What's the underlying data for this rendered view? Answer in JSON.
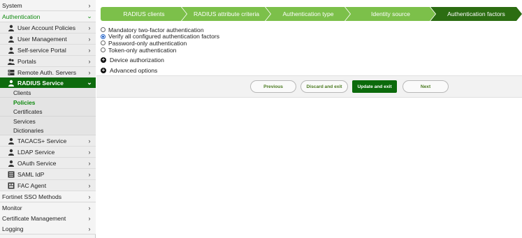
{
  "sidebar": {
    "items": [
      {
        "label": "System",
        "chevron": "›"
      },
      {
        "label": "Authentication",
        "chevron": "⌄"
      },
      {
        "label": "User Account Policies",
        "icon": "users-icon",
        "chevron": "›"
      },
      {
        "label": "User Management",
        "icon": "users-icon",
        "chevron": "›"
      },
      {
        "label": "Self-service Portal",
        "icon": "users-icon",
        "chevron": "›"
      },
      {
        "label": "Portals",
        "icon": "people-icon",
        "chevron": "›"
      },
      {
        "label": "Remote Auth. Servers",
        "icon": "server-icon",
        "chevron": "›"
      },
      {
        "label": "RADIUS Service",
        "icon": "users-icon",
        "chevron": "⌄"
      },
      {
        "label": "Clients"
      },
      {
        "label": "Policies"
      },
      {
        "label": "Certificates"
      },
      {
        "label": "Services"
      },
      {
        "label": "Dictionaries"
      },
      {
        "label": "TACACS+ Service",
        "icon": "users-icon",
        "chevron": "›"
      },
      {
        "label": "LDAP Service",
        "icon": "users-icon",
        "chevron": "›"
      },
      {
        "label": "OAuth Service",
        "icon": "users-icon",
        "chevron": "›"
      },
      {
        "label": "SAML IdP",
        "icon": "server-icon",
        "chevron": "›"
      },
      {
        "label": "FAC Agent",
        "icon": "agent-icon",
        "chevron": "›"
      },
      {
        "label": "Fortinet SSO Methods",
        "chevron": "›"
      },
      {
        "label": "Monitor",
        "chevron": "›"
      },
      {
        "label": "Certificate Management",
        "chevron": "›"
      },
      {
        "label": "Logging",
        "chevron": "›"
      }
    ]
  },
  "wizard": {
    "steps": [
      {
        "label": "RADIUS clients"
      },
      {
        "label": "RADIUS attribute criteria"
      },
      {
        "label": "Authentication type"
      },
      {
        "label": "Identity source"
      },
      {
        "label": "Authentication factors"
      }
    ],
    "active_step": "Authentication factors"
  },
  "auth_factors": {
    "options": [
      {
        "label": "Mandatory two-factor authentication",
        "checked": false
      },
      {
        "label": "Verify all configured authentication factors",
        "checked": true
      },
      {
        "label": "Password-only authentication",
        "checked": false
      },
      {
        "label": "Token-only authentication",
        "checked": false
      }
    ]
  },
  "sections": {
    "device_authorization": "Device authorization",
    "advanced_options": "Advanced options"
  },
  "buttons": {
    "previous": "Previous",
    "discard_and_exit": "Discard and exit",
    "update_and_exit": "Update and exit",
    "next": "Next"
  },
  "colors": {
    "brand_green": "#0b6a0b",
    "step_green": "#7cc04a",
    "step_active": "#2c6d12"
  }
}
